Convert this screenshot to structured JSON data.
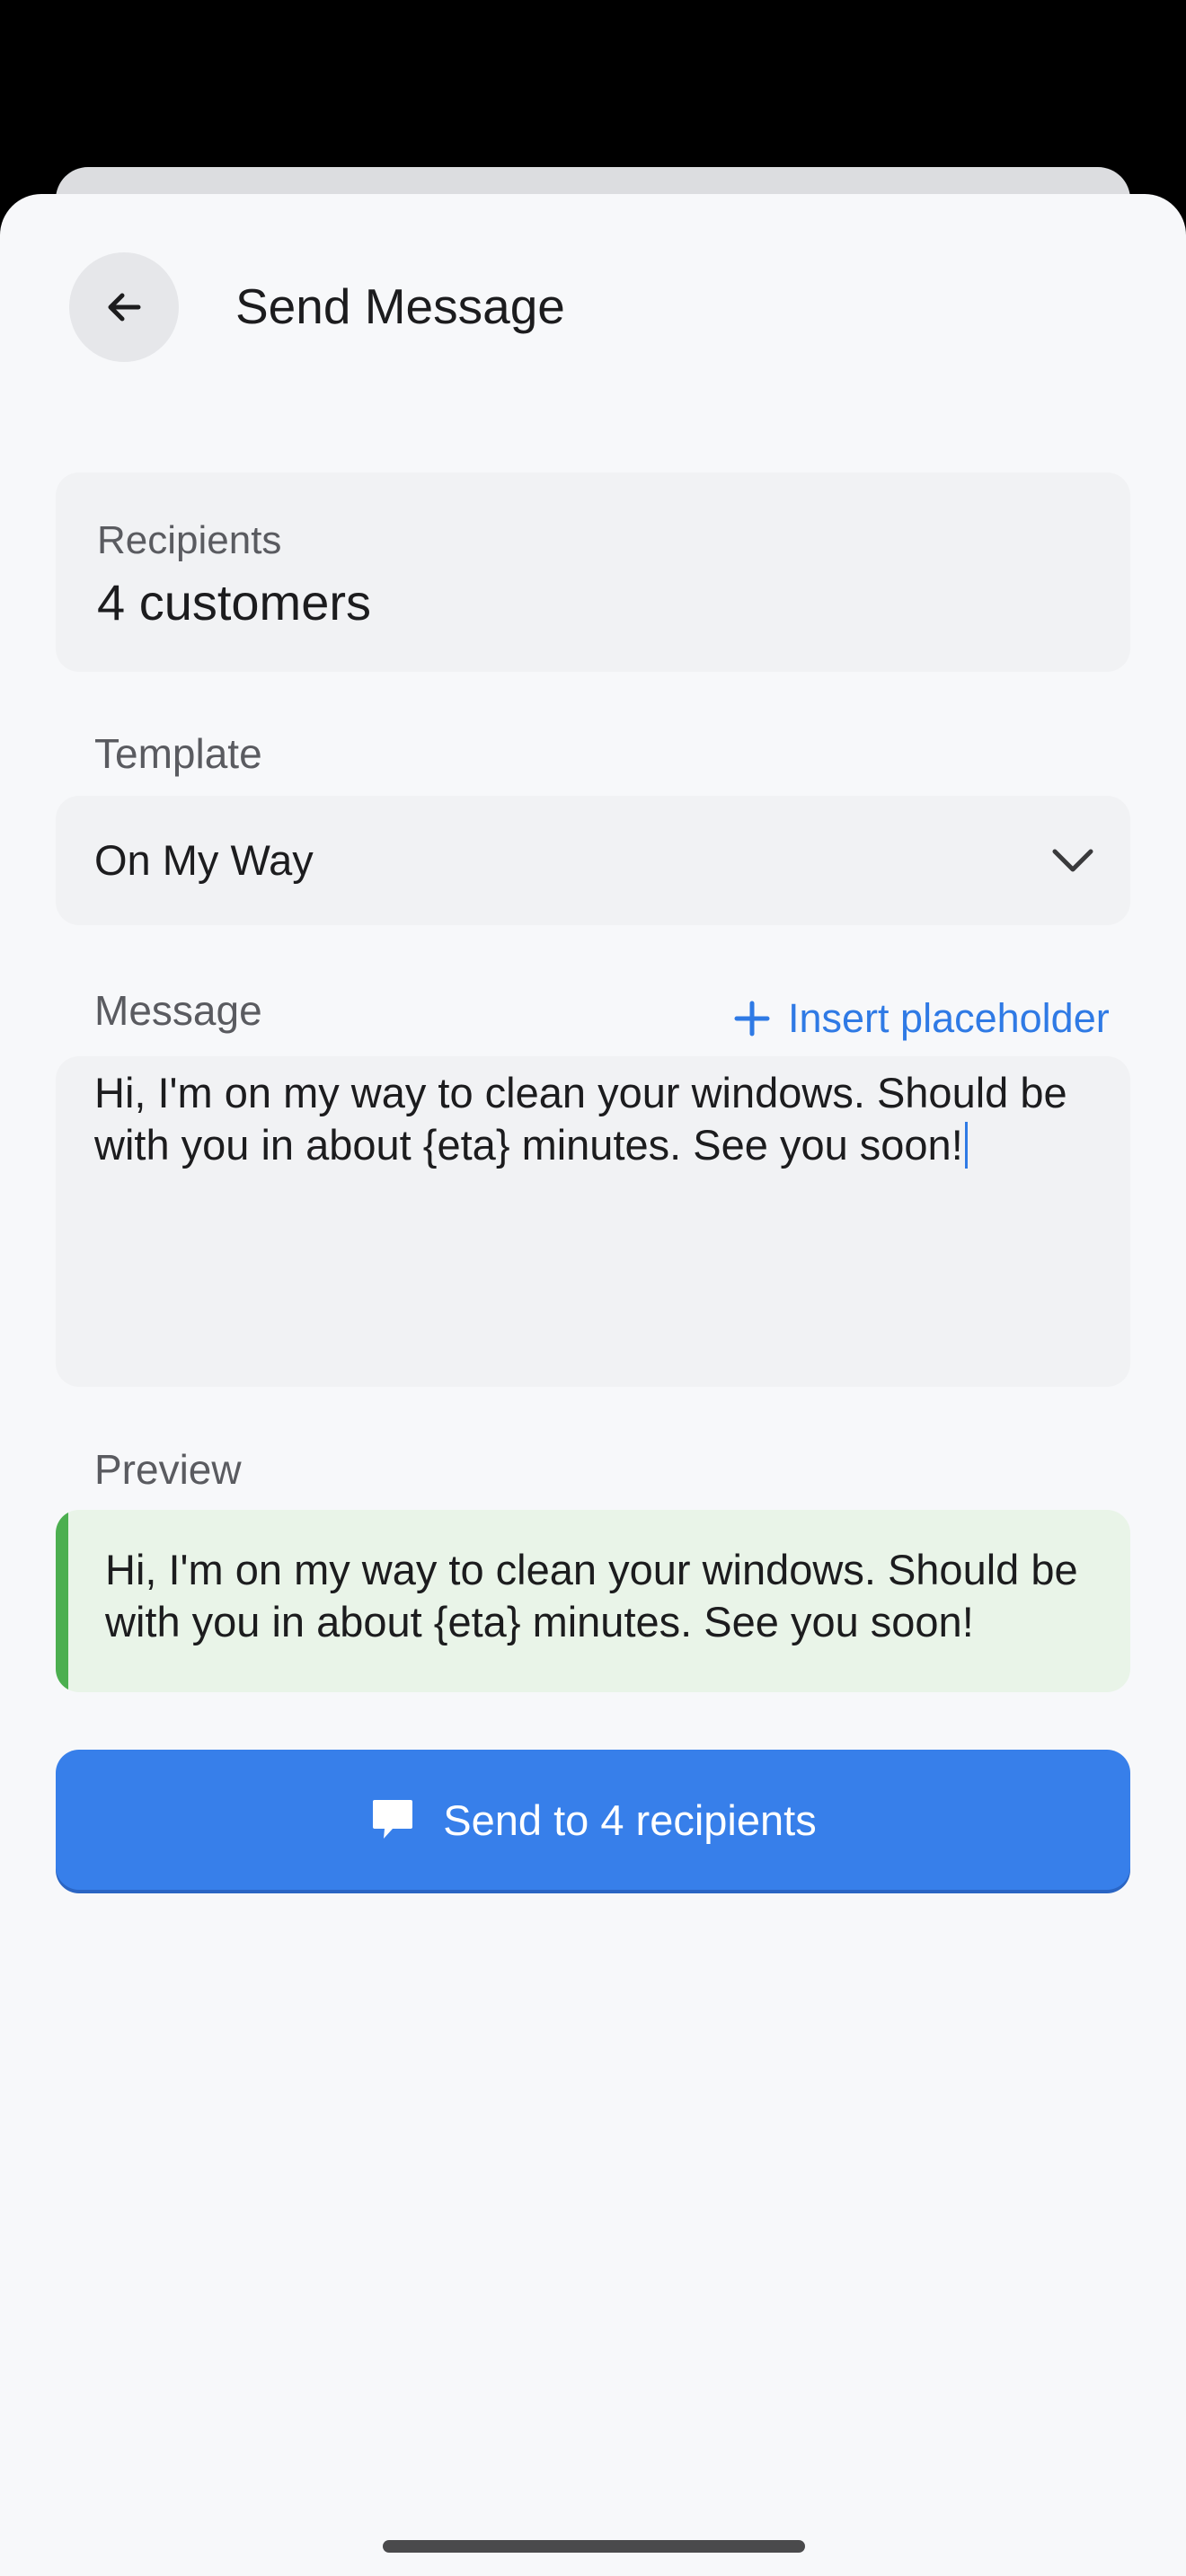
{
  "header": {
    "title": "Send Message",
    "back_icon": "arrow-left-icon"
  },
  "recipients": {
    "label": "Recipients",
    "value": "4 customers"
  },
  "template": {
    "label": "Template",
    "selected": "On My Way",
    "dropdown_icon": "chevron-down-icon"
  },
  "message": {
    "label": "Message",
    "insert_placeholder_label": "Insert placeholder",
    "insert_icon": "plus-icon",
    "text": "Hi, I'm on my way to clean your windows. Should be with you in about {eta} minutes. See you soon!"
  },
  "preview": {
    "label": "Preview",
    "text": "Hi, I'm on my way to clean your windows. Should be with you in about {eta} minutes. See you soon!",
    "accent_color": "#4caf50"
  },
  "send_button": {
    "label": "Send to 4 recipients",
    "icon": "chat-bubble-icon",
    "color": "#377fea"
  },
  "colors": {
    "accent": "#2f7ae5",
    "sheet_background": "#f7f8fa",
    "field_background": "#f1f2f4",
    "preview_background": "#e9f4e8"
  }
}
